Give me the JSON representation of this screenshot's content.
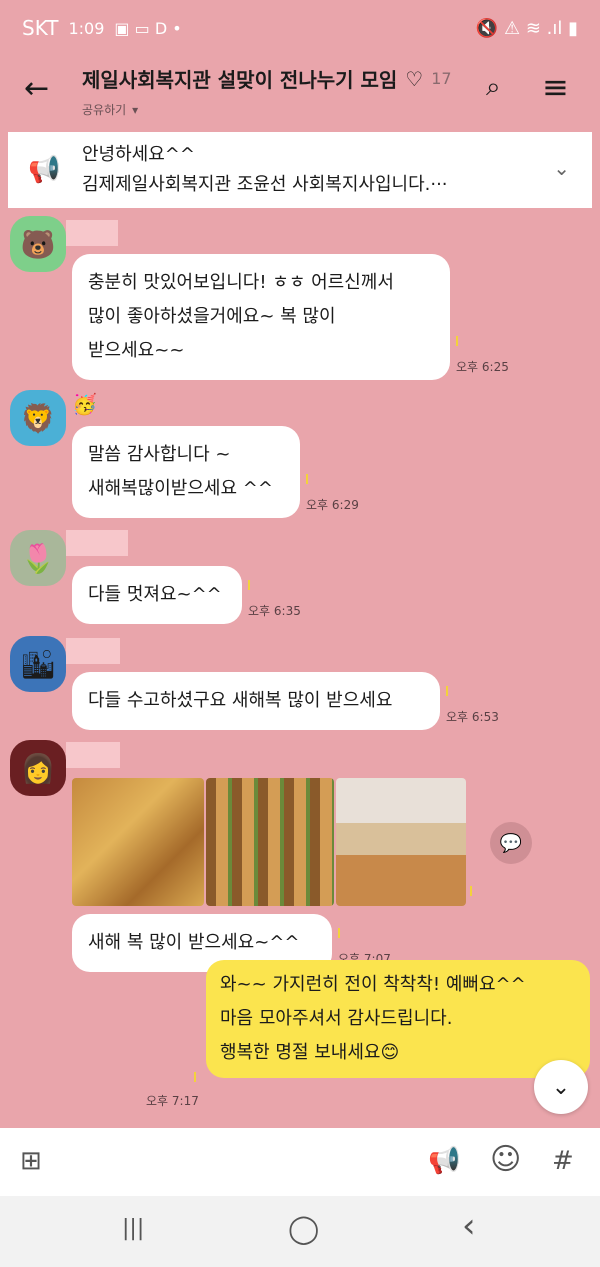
{
  "statusbar": {
    "carrier": "SKT",
    "time": "1:09",
    "left_icons": "▣ ▭ D •",
    "right_icons": "🔇 ⚠ ≋ .ıl ▮"
  },
  "header": {
    "back_icon": "←",
    "title": "제일사회복지관 설맞이 전나누기 모임",
    "heart": "♡",
    "member_count": "17",
    "share_label": "공유하기",
    "dropdown_icon": "▾",
    "search_icon": "⌕",
    "menu_icon": "≡"
  },
  "notice": {
    "icon": "📢",
    "line1": "안녕하세요^^",
    "line2": "김제제일사회복지관 조윤선 사회복지사입니다.···",
    "chevron": "⌄"
  },
  "messages": [
    {
      "avatar": "🐻",
      "text": "충분히 맛있어보입니다! ㅎㅎ 어르신께서\n많이 좋아하셨을거에요~ 복 많이\n받으세요~~",
      "time": "오후 6:25"
    },
    {
      "avatar": "🦁",
      "name_emoji": "🥳",
      "text": "말씀 감사합니다 ~\n새해복많이받으세요 ^^",
      "time": "오후 6:29"
    },
    {
      "avatar": "🌷",
      "text": "다들 멋져요~^^",
      "time": "오후 6:35"
    },
    {
      "avatar": "🏙",
      "text": "다들 수고하셨구요 새해복 많이 받으세요",
      "time": "오후 6:53"
    },
    {
      "avatar": "👩",
      "text": "새해 복 많이 받으세요~^^",
      "time": "오후 7:07"
    }
  ],
  "photo_share_icon": "💬",
  "my_message": {
    "text": "와~~ 가지런히 전이 착착착! 예뻐요^^\n마음 모아주셔서 감사드립니다.\n행복한 명절 보내세요😊",
    "time": "오후 7:17"
  },
  "scroll_down_icon": "⌄",
  "inputbar": {
    "plus_icon": "⊞",
    "announce_icon": "📢",
    "emoji_icon": "☺",
    "hash_icon": "#"
  },
  "navbar": {
    "recent_icon": "|||",
    "home_icon": "◯",
    "back_icon": "‹"
  },
  "colors": {
    "chat_bg": "#e9a5ab",
    "my_bubble": "#fbe44e",
    "other_bubble": "#ffffff"
  }
}
